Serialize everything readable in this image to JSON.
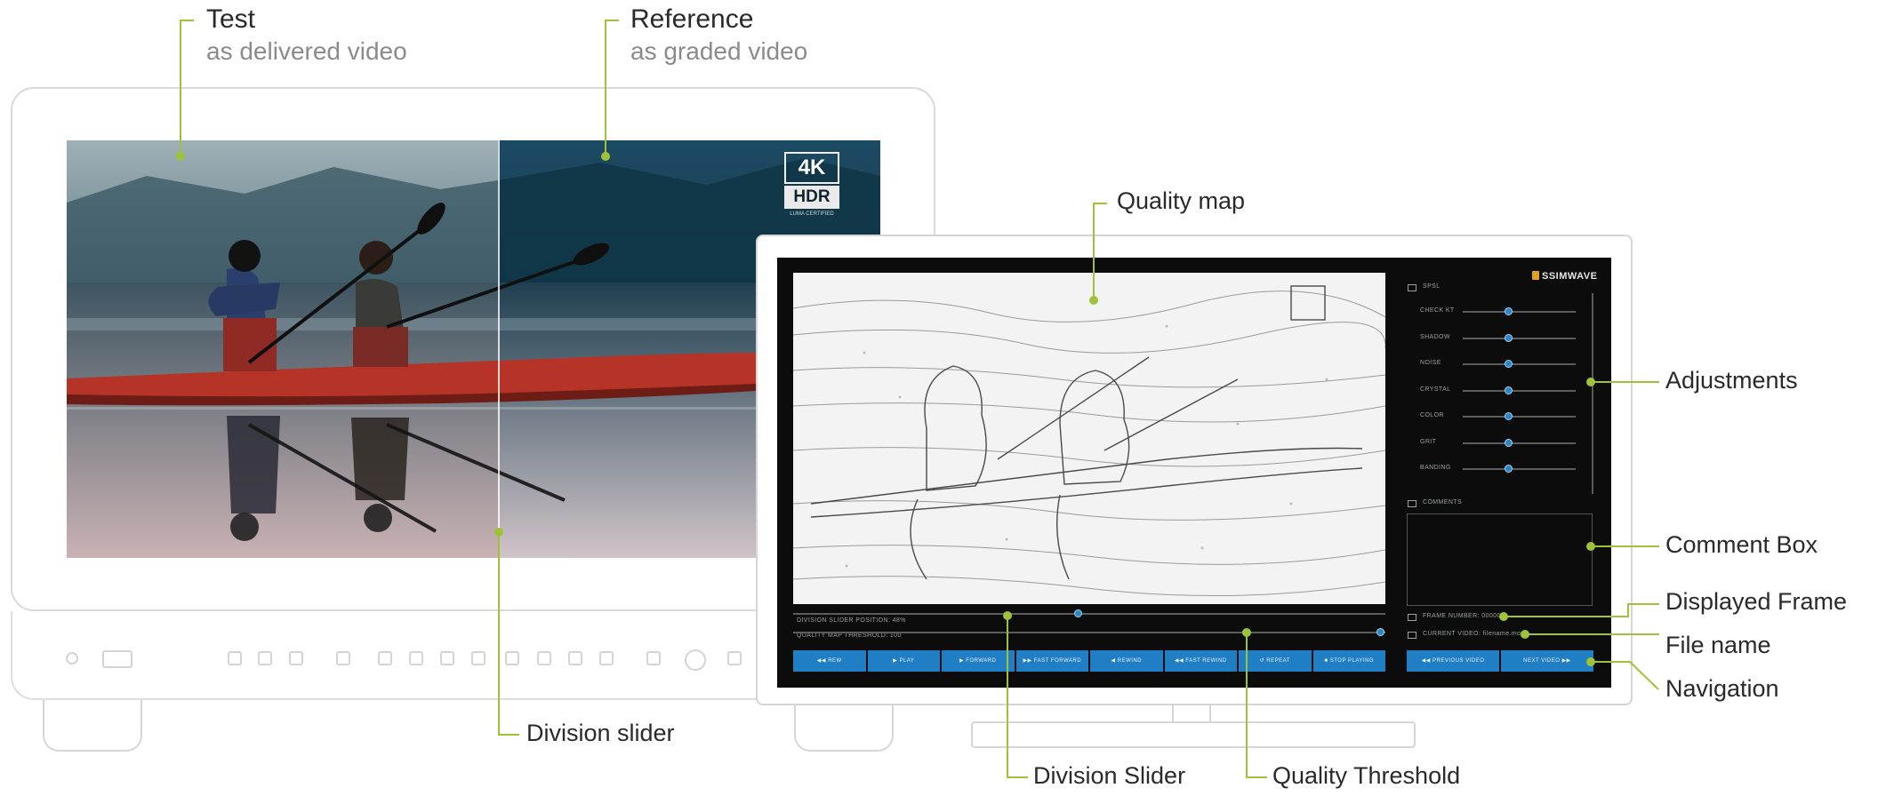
{
  "annotations": {
    "test": {
      "title": "Test",
      "subtitle": "as delivered video"
    },
    "reference": {
      "title": "Reference",
      "subtitle": "as graded video"
    },
    "quality_map": "Quality map",
    "adjustments": "Adjustments",
    "comment_box": "Comment Box",
    "displayed_frame": "Displayed Frame",
    "file_name": "File name",
    "navigation": "Navigation",
    "division_slider_left": "Division slider",
    "division_slider_right": "Division Slider",
    "quality_threshold": "Quality Threshold"
  },
  "left_monitor": {
    "badge": {
      "top": "4K",
      "bottom": "HDR",
      "small": "LUMA CERTIFIED"
    }
  },
  "app": {
    "logo": "SSIMWAVE",
    "adjust_header": "SPSL",
    "sliders": [
      {
        "label": "CHECK KT",
        "value": 0.4
      },
      {
        "label": "SHADOW",
        "value": 0.4
      },
      {
        "label": "NOISE",
        "value": 0.4
      },
      {
        "label": "CRYSTAL",
        "value": 0.4
      },
      {
        "label": "COLOR",
        "value": 0.4
      },
      {
        "label": "GRIT",
        "value": 0.4
      },
      {
        "label": "BANDING",
        "value": 0.4
      }
    ],
    "comments_header": "COMMENTS",
    "division_slider": {
      "label": "DIVISION SLIDER POSITION: 48%",
      "value": 0.48
    },
    "quality_threshold": {
      "label": "QUALITY MAP THRESHOLD: 100",
      "value": 1.0
    },
    "frame_label": "FRAME NUMBER: 000001",
    "file_label": "CURRENT VIDEO: filename.mov",
    "playback_buttons": [
      "◀◀ REW",
      "▶ PLAY",
      "▶ FORWARD",
      "▶▶ FAST FORWARD",
      "◀ REWIND",
      "◀◀ FAST REWIND",
      "↺ REPEAT",
      "■ STOP PLAYING"
    ],
    "nav_buttons": [
      "◀◀ PREVIOUS VIDEO",
      "NEXT VIDEO ▶▶"
    ]
  },
  "colors": {
    "accent": "#9ec33a",
    "button": "#1f7ec4",
    "screen": "#0c0c0c"
  }
}
